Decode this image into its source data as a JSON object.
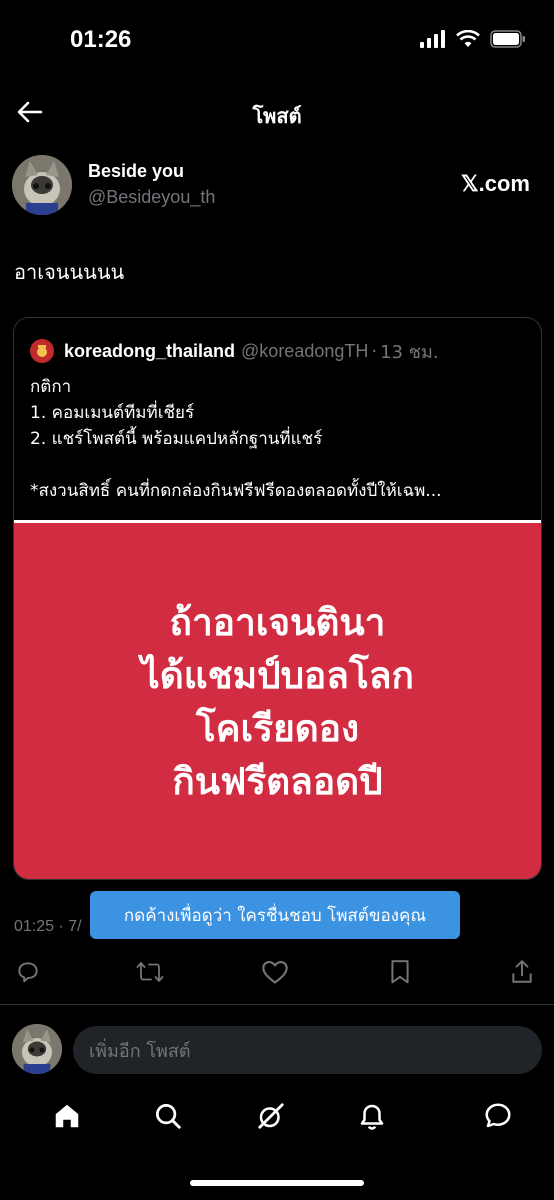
{
  "status_bar": {
    "time": "01:26"
  },
  "nav": {
    "title": "โพสต์"
  },
  "post": {
    "author_name": "Beside you",
    "author_handle": "@Besideyou_th",
    "source_label": "𝕏.com",
    "text": "อาเจนนนนน",
    "meta": "01:25 · 7/"
  },
  "quote": {
    "name": "koreadong_thailand",
    "handle": "@koreadongTH",
    "separator": "·",
    "time": "13 ชม.",
    "lines": [
      "กติกา",
      "1. คอมเมนต์ทีมที่เชียร์",
      "2. แชร์โพสต์นี้ พร้อมแคปหลักฐานที่แชร์",
      "",
      "*สงวนสิทธิ์ คนที่กดกล่องกินฟรีฟรีดองตลอดทั้งปีให้เฉพ..."
    ],
    "image_lines": [
      "ถ้าอาเจนตินา",
      "ได้แชมป์บอลโลก",
      "โคเรียดอง",
      "กินฟรีตลอดปี"
    ]
  },
  "tooltip": {
    "text": "กดค้างเพื่อดูว่า ใครชื่นชอบ โพสต์ของคุณ"
  },
  "actions": [
    {
      "name": "reply-icon"
    },
    {
      "name": "repost-icon"
    },
    {
      "name": "like-icon"
    },
    {
      "name": "bookmark-icon"
    },
    {
      "name": "share-icon"
    }
  ],
  "reply": {
    "placeholder": "เพิ่มอีก โพสต์"
  },
  "tabs": [
    {
      "name": "home-icon"
    },
    {
      "name": "search-icon"
    },
    {
      "name": "grok-icon"
    },
    {
      "name": "bell-icon"
    },
    {
      "name": "messages-icon"
    }
  ],
  "colors": {
    "background": "#000000",
    "accent": "#3b93e2",
    "image_red": "#d12c42",
    "secondary_text": "#71767b"
  }
}
